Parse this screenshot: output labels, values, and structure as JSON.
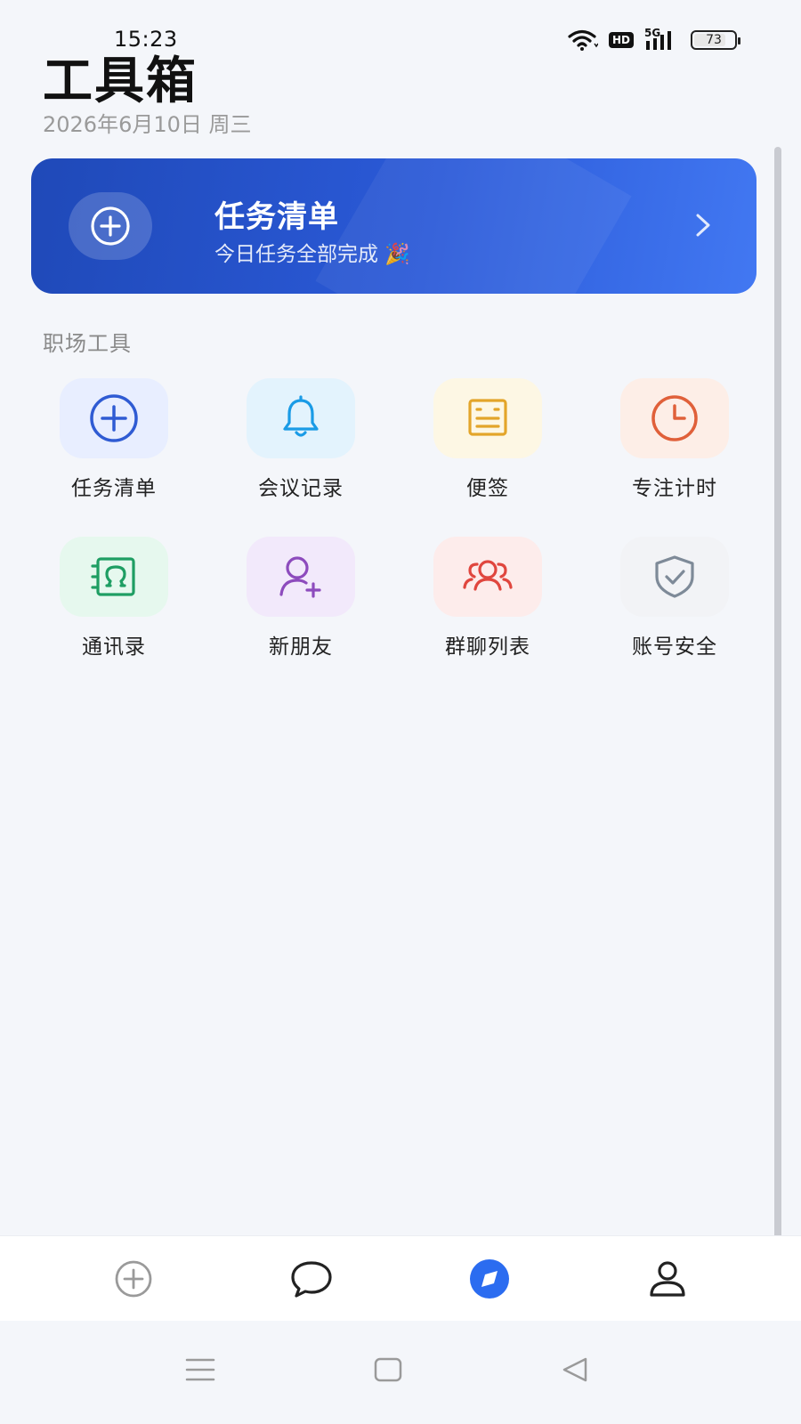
{
  "status_bar": {
    "time": "15:23",
    "battery": "73",
    "network": "5G",
    "hd": "HD"
  },
  "header": {
    "title": "工具箱",
    "date": "2026年6月10日 周三"
  },
  "banner": {
    "title": "任务清单",
    "subtitle": "今日任务全部完成 🎉",
    "icon": "plus-circle-icon"
  },
  "section": {
    "title": "职场工具"
  },
  "tools": [
    {
      "label": "任务清单",
      "icon": "plus-circle-icon",
      "color": "#2f5bd3",
      "bg": "#e8eeff"
    },
    {
      "label": "会议记录",
      "icon": "bell-icon",
      "color": "#1a9be6",
      "bg": "#e3f3fd"
    },
    {
      "label": "便签",
      "icon": "note-icon",
      "color": "#e3a52a",
      "bg": "#fdf7e4"
    },
    {
      "label": "专注计时",
      "icon": "clock-icon",
      "color": "#e0603a",
      "bg": "#fdeee7"
    },
    {
      "label": "通讯录",
      "icon": "contacts-icon",
      "color": "#1f9e63",
      "bg": "#e6f8ee"
    },
    {
      "label": "新朋友",
      "icon": "add-user-icon",
      "color": "#8d4bbd",
      "bg": "#f2e9fb"
    },
    {
      "label": "群聊列表",
      "icon": "group-icon",
      "color": "#e0463e",
      "bg": "#fdeceb"
    },
    {
      "label": "账号安全",
      "icon": "shield-check-icon",
      "color": "#7e8a98",
      "bg": "#f2f3f6"
    }
  ],
  "bottom_nav": [
    {
      "icon": "plus-circle-icon",
      "active": false
    },
    {
      "icon": "chat-bubble-icon",
      "active": false
    },
    {
      "icon": "compass-icon",
      "active": true
    },
    {
      "icon": "profile-icon",
      "active": false
    }
  ],
  "colors": {
    "accent": "#2b6cf0",
    "banner_start": "#1f49b8",
    "banner_end": "#4278f2",
    "background": "#f4f6fa"
  }
}
